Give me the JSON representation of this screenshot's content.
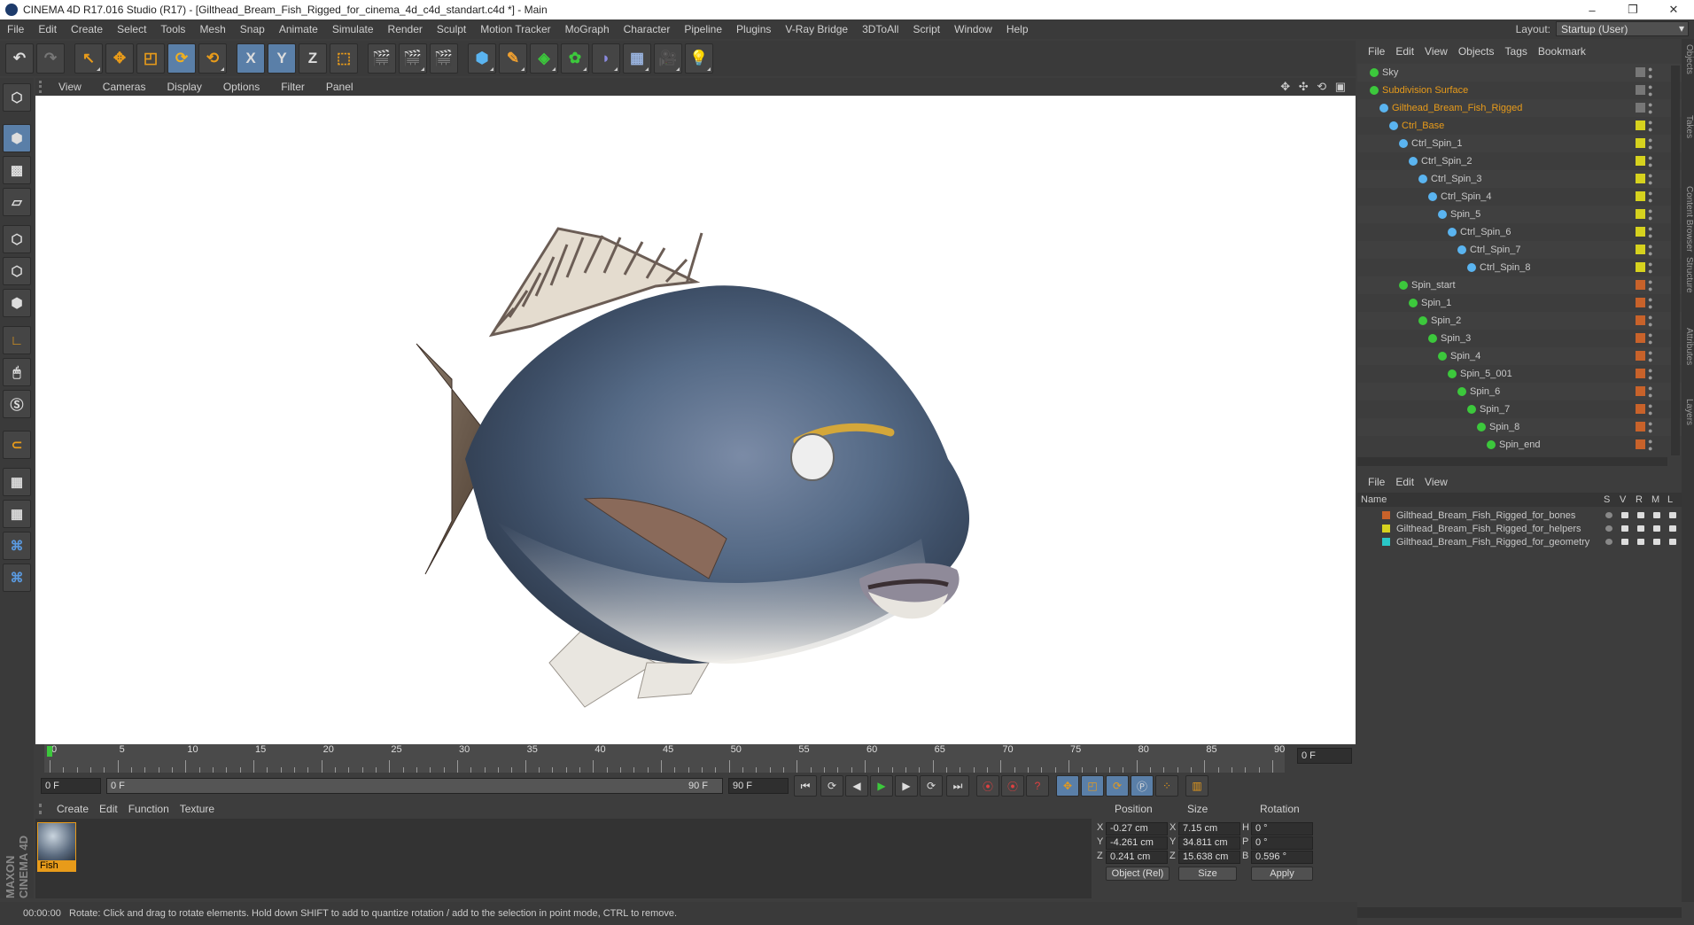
{
  "window": {
    "title": "CINEMA 4D R17.016 Studio (R17) - [Gilthead_Bream_Fish_Rigged_for_cinema_4d_c4d_standart.c4d *] - Main",
    "min": "–",
    "max": "❐",
    "close": "✕"
  },
  "menubar": [
    "File",
    "Edit",
    "Create",
    "Select",
    "Tools",
    "Mesh",
    "Snap",
    "Animate",
    "Simulate",
    "Render",
    "Sculpt",
    "Motion Tracker",
    "MoGraph",
    "Character",
    "Pipeline",
    "Plugins",
    "V-Ray Bridge",
    "3DToAll",
    "Script",
    "Window",
    "Help"
  ],
  "layout": {
    "label": "Layout:",
    "value": "Startup (User)"
  },
  "toolbar": {
    "x_label": "X",
    "y_label": "Y",
    "z_label": "Z"
  },
  "viewport": {
    "menu": [
      "View",
      "Cameras",
      "Display",
      "Options",
      "Filter",
      "Panel"
    ],
    "nav_icons": "✥ ✣ ⟲ ▣"
  },
  "timeline": {
    "ticks": [
      "0",
      "5",
      "10",
      "15",
      "20",
      "25",
      "30",
      "35",
      "40",
      "45",
      "50",
      "55",
      "60",
      "65",
      "70",
      "75",
      "80",
      "85",
      "90"
    ],
    "end_field": "0 F"
  },
  "playback": {
    "start": "0 F",
    "range_start": "0 F",
    "range_end": "90 F",
    "end": "90 F"
  },
  "material_manager": {
    "menu": [
      "Create",
      "Edit",
      "Function",
      "Texture"
    ],
    "material_name": "Fish"
  },
  "branding": "MAXON CINEMA 4D",
  "coordinates": {
    "headers": {
      "position": "Position",
      "size": "Size",
      "rotation": "Rotation"
    },
    "rows": [
      {
        "axis": "X",
        "pos": "-0.27 cm",
        "saxis": "X",
        "size": "7.15 cm",
        "raxis": "H",
        "rot": "0 °"
      },
      {
        "axis": "Y",
        "pos": "-4.261 cm",
        "saxis": "Y",
        "size": "34.811 cm",
        "raxis": "P",
        "rot": "0 °"
      },
      {
        "axis": "Z",
        "pos": "0.241 cm",
        "saxis": "Z",
        "size": "15.638 cm",
        "raxis": "B",
        "rot": "0.596 °"
      }
    ],
    "mode": "Object (Rel)",
    "size_mode": "Size",
    "apply": "Apply"
  },
  "status": {
    "time": "00:00:00",
    "message": "Rotate: Click and drag to rotate elements. Hold down SHIFT to add to quantize rotation / add to the selection in point mode, CTRL to remove."
  },
  "object_manager": {
    "menu": [
      "File",
      "Edit",
      "View",
      "Objects",
      "Tags",
      "Bookmark"
    ],
    "items": [
      {
        "name": "Sky",
        "depth": 0,
        "color": "#c8c8c8",
        "tag": "#777777"
      },
      {
        "name": "Subdivision Surface",
        "depth": 0,
        "color": "#e89b1a",
        "tag": "#777777"
      },
      {
        "name": "Gilthead_Bream_Fish_Rigged",
        "depth": 1,
        "color": "#e89b1a",
        "tag": "#777777"
      },
      {
        "name": "Ctrl_Base",
        "depth": 2,
        "color": "#e89b1a",
        "tag": "#d6d21e"
      },
      {
        "name": "Ctrl_Spin_1",
        "depth": 3,
        "color": "#c8c8c8",
        "tag": "#d6d21e"
      },
      {
        "name": "Ctrl_Spin_2",
        "depth": 4,
        "color": "#c8c8c8",
        "tag": "#d6d21e"
      },
      {
        "name": "Ctrl_Spin_3",
        "depth": 5,
        "color": "#c8c8c8",
        "tag": "#d6d21e"
      },
      {
        "name": "Ctrl_Spin_4",
        "depth": 6,
        "color": "#c8c8c8",
        "tag": "#d6d21e"
      },
      {
        "name": "Spin_5",
        "depth": 7,
        "color": "#c8c8c8",
        "tag": "#d6d21e"
      },
      {
        "name": "Ctrl_Spin_6",
        "depth": 8,
        "color": "#c8c8c8",
        "tag": "#d6d21e"
      },
      {
        "name": "Ctrl_Spin_7",
        "depth": 9,
        "color": "#c8c8c8",
        "tag": "#d6d21e"
      },
      {
        "name": "Ctrl_Spin_8",
        "depth": 10,
        "color": "#c8c8c8",
        "tag": "#d6d21e"
      },
      {
        "name": "Spin_start",
        "depth": 3,
        "color": "#c8c8c8",
        "tag": "#c8622a"
      },
      {
        "name": "Spin_1",
        "depth": 4,
        "color": "#c8c8c8",
        "tag": "#c8622a"
      },
      {
        "name": "Spin_2",
        "depth": 5,
        "color": "#c8c8c8",
        "tag": "#c8622a"
      },
      {
        "name": "Spin_3",
        "depth": 6,
        "color": "#c8c8c8",
        "tag": "#c8622a"
      },
      {
        "name": "Spin_4",
        "depth": 7,
        "color": "#c8c8c8",
        "tag": "#c8622a"
      },
      {
        "name": "Spin_5_001",
        "depth": 8,
        "color": "#c8c8c8",
        "tag": "#c8622a"
      },
      {
        "name": "Spin_6",
        "depth": 9,
        "color": "#c8c8c8",
        "tag": "#c8622a"
      },
      {
        "name": "Spin_7",
        "depth": 10,
        "color": "#c8c8c8",
        "tag": "#c8622a"
      },
      {
        "name": "Spin_8",
        "depth": 11,
        "color": "#c8c8c8",
        "tag": "#c8622a"
      },
      {
        "name": "Spin_end",
        "depth": 12,
        "color": "#c8c8c8",
        "tag": "#c8622a"
      }
    ]
  },
  "layer_manager": {
    "menu": [
      "File",
      "Edit",
      "View"
    ],
    "header": {
      "name": "Name",
      "cols": [
        "S",
        "V",
        "R",
        "M",
        "L"
      ]
    },
    "layers": [
      {
        "name": "Gilthead_Bream_Fish_Rigged_for_bones",
        "color": "#c8622a"
      },
      {
        "name": "Gilthead_Bream_Fish_Rigged_for_helpers",
        "color": "#d6d21e"
      },
      {
        "name": "Gilthead_Bream_Fish_Rigged_for_geometry",
        "color": "#2ac8c8"
      }
    ]
  },
  "side_tabs": [
    "Objects",
    "Takes",
    "Content Browser",
    "Structure",
    "Attributes",
    "Layers"
  ]
}
